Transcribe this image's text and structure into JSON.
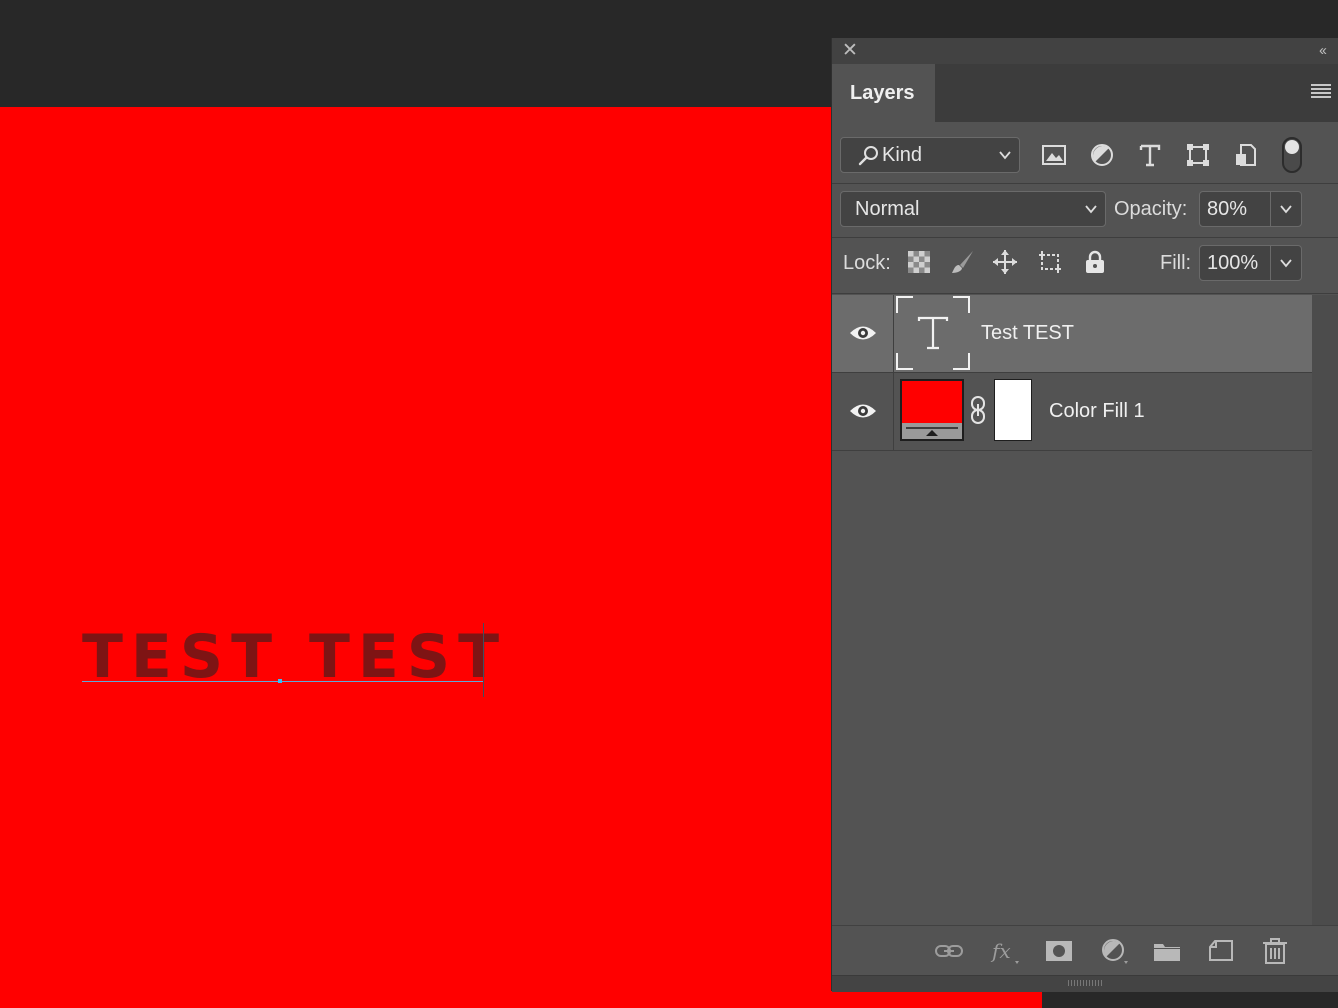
{
  "canvas": {
    "fill_color": "#ff0000",
    "text": "TEST TEST",
    "text_color": "#7e1414"
  },
  "panel": {
    "tab_label": "Layers",
    "close_icon": "close-icon",
    "collapse_icon": "double-chevron-left-icon",
    "menu_icon": "hamburger-menu-icon"
  },
  "filter": {
    "kind_label": "Kind",
    "icons": [
      "image-filter-icon",
      "adjustment-filter-icon",
      "type-filter-icon",
      "shape-filter-icon",
      "smart-object-filter-icon"
    ]
  },
  "blend": {
    "mode": "Normal",
    "opacity_label": "Opacity:",
    "opacity_value": "80%",
    "fill_label": "Fill:",
    "fill_value": "100%"
  },
  "lock": {
    "label": "Lock:",
    "icons": [
      "lock-transparent-pixels-icon",
      "lock-image-pixels-icon",
      "lock-position-icon",
      "lock-artboard-icon",
      "lock-all-icon"
    ]
  },
  "layers": [
    {
      "name": "Test TEST",
      "type": "text",
      "selected": true,
      "visible": true
    },
    {
      "name": "Color Fill 1",
      "type": "color-fill",
      "selected": false,
      "visible": true,
      "fill_color": "#ff0000"
    }
  ],
  "bottom_icons": [
    "link-layers-icon",
    "fx-icon",
    "add-mask-icon",
    "adjustment-layer-icon",
    "new-group-icon",
    "new-layer-icon",
    "trash-icon"
  ],
  "colors": {
    "accent_selection": "#6c6c6c",
    "panel_bg": "#535353",
    "app_bg": "#282828"
  }
}
